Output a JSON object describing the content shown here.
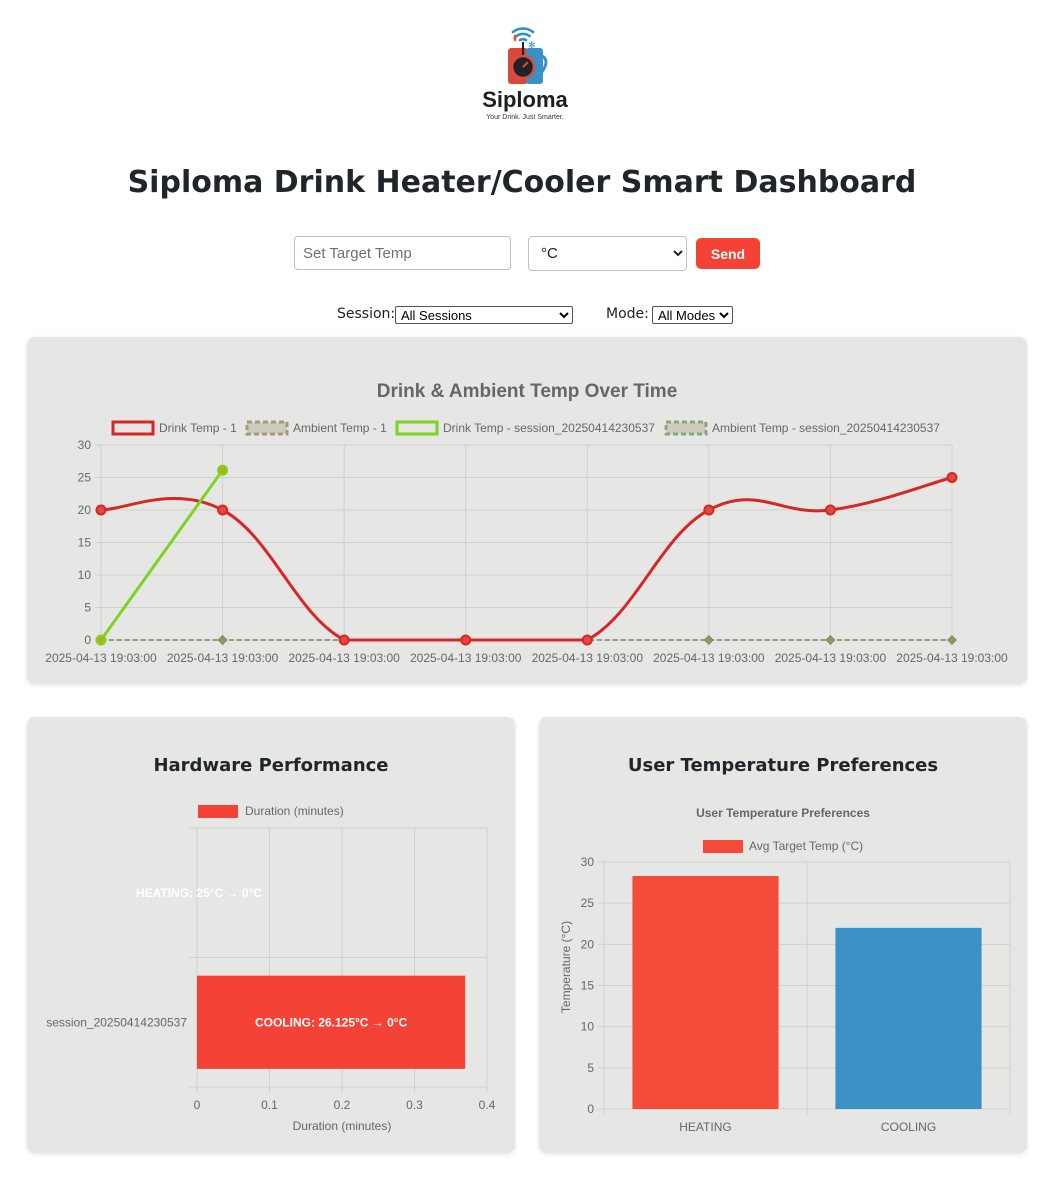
{
  "logo": {
    "name": "Siploma",
    "tagline": "Your Drink. Just Smarter."
  },
  "page_title": "Siploma Drink Heater/Cooler Smart Dashboard",
  "controls": {
    "target_placeholder": "Set Target Temp",
    "unit_selected": "°C",
    "send_label": "Send"
  },
  "filters": {
    "session_label": "Session:",
    "session_selected": "All Sessions",
    "mode_label": "Mode:",
    "mode_selected": "All Modes"
  },
  "colors": {
    "accent_red": "#f44336",
    "drink_red": "#d62728",
    "session_green": "#7ed321",
    "cooling_blue": "#3b90c4",
    "card_bg": "#e6e7e5"
  },
  "chart_data": [
    {
      "type": "line",
      "title": "Drink & Ambient Temp Over Time",
      "categories": [
        "2025-04-13 19:03:00",
        "2025-04-13 19:03:00",
        "2025-04-13 19:03:00",
        "2025-04-13 19:03:00",
        "2025-04-13 19:03:00",
        "2025-04-13 19:03:00",
        "2025-04-13 19:03:00",
        "2025-04-13 19:03:00"
      ],
      "ylim": [
        0,
        30
      ],
      "yticks": [
        0,
        5,
        10,
        15,
        20,
        25,
        30
      ],
      "grid": true,
      "legend_position": "top",
      "series": [
        {
          "name": "Drink Temp - 1",
          "values": [
            20,
            20,
            0,
            0,
            0,
            20,
            20,
            25
          ],
          "color": "#d62728",
          "style": "solid-smooth"
        },
        {
          "name": "Ambient Temp - 1",
          "values": [
            0,
            0,
            0,
            0,
            0,
            0,
            0,
            0
          ],
          "color": "#a39a7e",
          "style": "dashed"
        },
        {
          "name": "Drink Temp - session_20250414230537",
          "values": [
            0,
            26.125,
            null,
            null,
            null,
            null,
            null,
            null
          ],
          "color": "#7ed321",
          "style": "solid"
        },
        {
          "name": "Ambient Temp - session_20250414230537",
          "values": [
            0,
            0,
            null,
            null,
            null,
            null,
            null,
            null
          ],
          "color": "#8aa67e",
          "style": "dashed"
        }
      ]
    },
    {
      "type": "bar",
      "orientation": "horizontal",
      "title": "Hardware Performance",
      "categories": [
        "",
        "session_20250414230537"
      ],
      "series": [
        {
          "name": "Duration (minutes)",
          "values": [
            0,
            0.37
          ]
        }
      ],
      "bar_labels": [
        "HEATING: 25°C → 0°C",
        "COOLING: 26.125°C → 0°C"
      ],
      "xlabel": "Duration (minutes)",
      "xlim": [
        0,
        0.4
      ],
      "xticks": [
        "0",
        "0.1",
        "0.2",
        "0.3",
        "0.4"
      ],
      "legend_position": "top"
    },
    {
      "type": "bar",
      "title": "User Temperature Preferences",
      "subtitle": "User Temperature Preferences",
      "categories": [
        "HEATING",
        "COOLING"
      ],
      "series": [
        {
          "name": "Avg Target Temp (°C)",
          "values": [
            28.3,
            22
          ]
        }
      ],
      "bar_colors": [
        "#f44c38",
        "#3b90c4"
      ],
      "ylabel": "Temperature (°C)",
      "ylim": [
        0,
        30
      ],
      "yticks": [
        0,
        5,
        10,
        15,
        20,
        25,
        30
      ],
      "legend_position": "top"
    }
  ]
}
